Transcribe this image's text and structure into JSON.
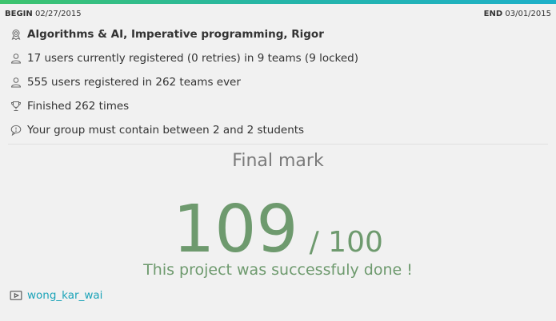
{
  "dates": {
    "begin_label": "BEGIN",
    "begin_value": "02/27/2015",
    "end_label": "END",
    "end_value": "03/01/2015"
  },
  "info": {
    "skills": "Algorithms & AI, Imperative programming, Rigor",
    "current_users": "17 users currently registered (0 retries) in 9 teams (9 locked)",
    "total_users": "555 users registered in 262 teams ever",
    "finished": "Finished 262 times",
    "group_rule": "Your group must contain between 2 and 2 students"
  },
  "final": {
    "title": "Final mark",
    "score": "109",
    "max": "/ 100",
    "message": "This project was successfuly done !"
  },
  "leader": {
    "name": "wong_kar_wai"
  },
  "colors": {
    "accent_green": "#6e9a6e",
    "link": "#1ba3b8",
    "topbar_start": "#3ec46d",
    "topbar_end": "#1eb0c9"
  },
  "icons": [
    "badge-icon",
    "user-icon",
    "user-icon",
    "trophy-icon",
    "speech-bubble-icon",
    "video-icon"
  ]
}
